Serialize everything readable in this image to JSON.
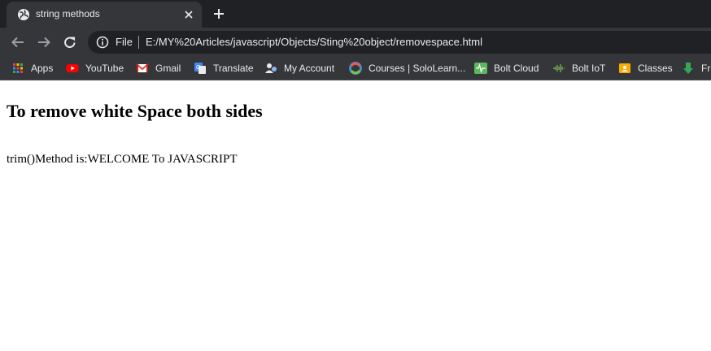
{
  "browser": {
    "tab": {
      "title": "string methods",
      "favicon": "globe-icon"
    },
    "nav": {
      "back": "arrow-left-icon",
      "forward": "arrow-right-icon",
      "reload": "reload-icon"
    },
    "omnibox": {
      "scheme_label": "File",
      "url": "E:/MY%20Articles/javascript/Objects/Sting%20object/removespace.html"
    },
    "bookmarks": [
      {
        "label": "Apps",
        "icon": "apps-grid-icon"
      },
      {
        "label": "YouTube",
        "icon": "youtube-icon"
      },
      {
        "label": "Gmail",
        "icon": "gmail-icon"
      },
      {
        "label": "Translate",
        "icon": "translate-icon"
      },
      {
        "label": "My Account",
        "icon": "account-icon"
      },
      {
        "label": "Courses | SoloLearn...",
        "icon": "sololearn-icon"
      },
      {
        "label": "Bolt Cloud",
        "icon": "bolt-cloud-icon"
      },
      {
        "label": "Bolt IoT",
        "icon": "bolt-iot-icon"
      },
      {
        "label": "Classes",
        "icon": "classes-icon"
      },
      {
        "label": "Fre",
        "icon": "download-arrow-icon"
      }
    ],
    "colors": {
      "tabstrip": "#202124",
      "toolbar": "#35363a",
      "text": "#e8eaed"
    }
  },
  "page": {
    "heading": "To remove white Space both sides",
    "output": "trim()Method is:WELCOME To JAVASCRIPT"
  }
}
